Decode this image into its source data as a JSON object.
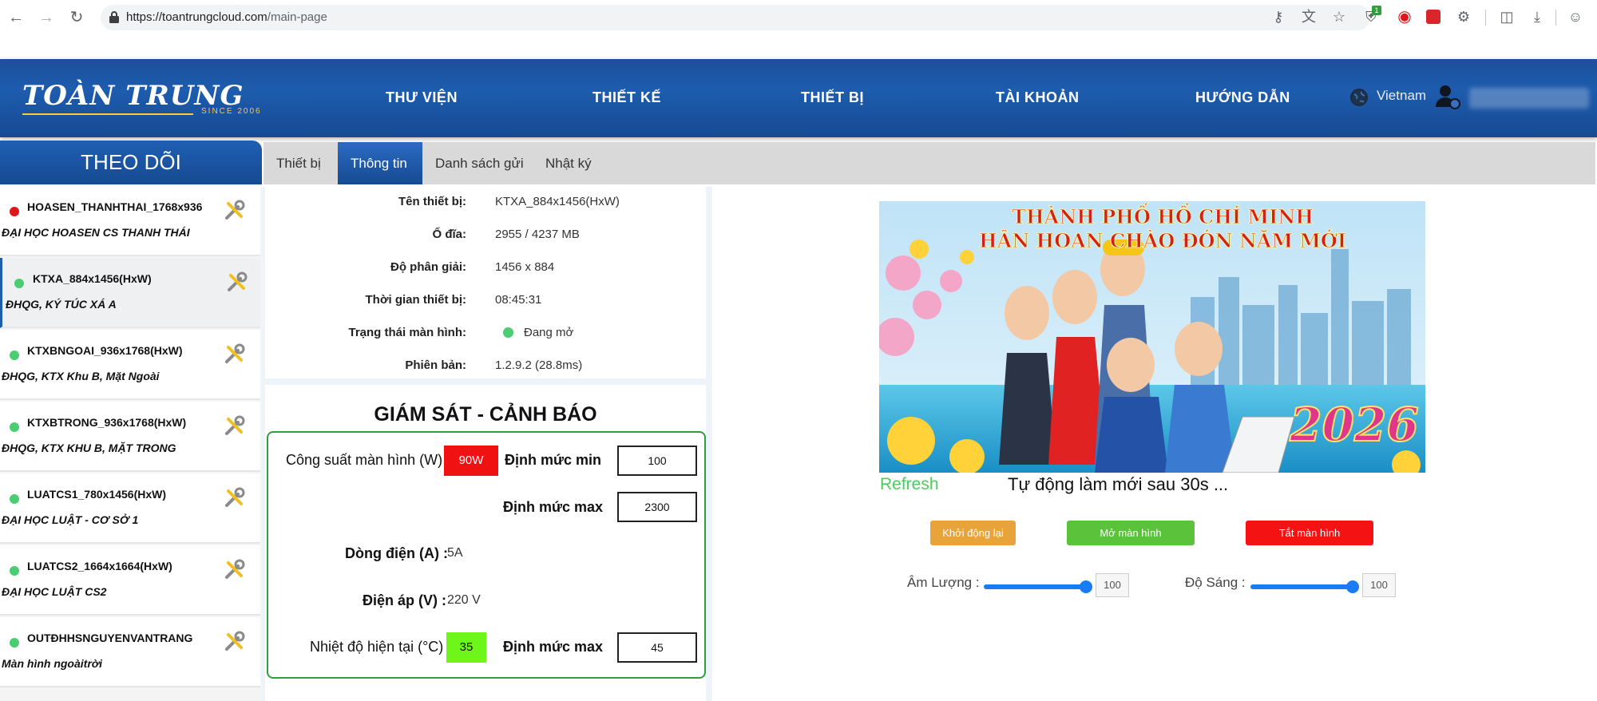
{
  "browser": {
    "url_host": "https://toantrungcloud.com",
    "url_path": "/main-page",
    "badge_count": "1"
  },
  "header": {
    "logo": "TOÀN TRUNG",
    "logo_sub": "SINCE 2006",
    "nav": [
      "THƯ VIỆN",
      "THIẾT KẾ",
      "THIẾT BỊ",
      "TÀI KHOẢN",
      "HƯỚNG DẪN"
    ],
    "language": "Vietnam"
  },
  "sidebar": {
    "title": "THEO DÕI",
    "items": [
      {
        "name": "HOASEN_THANHTHAI_1768x936",
        "desc": "ĐẠI HỌC HOASEN CS THANH THÁI",
        "status": "#e0161a"
      },
      {
        "name": "KTXA_884x1456(HxW)",
        "desc": "ĐHQG, KÝ TÚC XÁ A",
        "status": "#4ccd72"
      },
      {
        "name": "KTXBNGOAI_936x1768(HxW)",
        "desc": "ĐHQG, KTX Khu B, Mặt Ngoài",
        "status": "#4ccd72"
      },
      {
        "name": "KTXBTRONG_936x1768(HxW)",
        "desc": "ĐHQG, KTX KHU B, MẶT TRONG",
        "status": "#4ccd72"
      },
      {
        "name": "LUATCS1_780x1456(HxW)",
        "desc": "ĐẠI HỌC LUẬT - CƠ SỞ 1",
        "status": "#4ccd72"
      },
      {
        "name": "LUATCS2_1664x1664(HxW)",
        "desc": "ĐẠI HỌC LUẬT CS2",
        "status": "#4ccd72"
      },
      {
        "name": "OUTĐHHSNGUYENVANTRANG",
        "desc": "Màn hình ngoàitrời",
        "status": "#4ccd72"
      }
    ]
  },
  "tabs": [
    "Thiết bị",
    "Thông tin",
    "Danh sách gửi",
    "Nhật ký"
  ],
  "info": {
    "device_name_label": "Tên thiết bị:",
    "device_name": "KTXA_884x1456(HxW)",
    "disk_label": "Ổ đĩa:",
    "disk": "2955 / 4237 MB",
    "resolution_label": "Độ phân giải:",
    "resolution": "1456 x 884",
    "time_label": "Thời gian thiết bị:",
    "time": "08:45:31",
    "screen_state_label": "Trạng thái màn hình:",
    "screen_state": "Đang mở",
    "version_label": "Phiên bản:",
    "version": "1.2.9.2 (28.8ms)"
  },
  "monitor": {
    "title": "GIÁM SÁT - CẢNH BÁO",
    "power_label": "Công suất màn hình (W)",
    "power_value": "90W",
    "min_label": "Định mức min",
    "min_value": "100",
    "max_label": "Định mức max",
    "max_value": "2300",
    "current_label": "Dòng điện (A) :",
    "current_value": "5A",
    "voltage_label": "Điện áp (V) :",
    "voltage_value": "220 V",
    "temp_label": "Nhiệt độ hiện tại (°C)",
    "temp_value": "35",
    "temp_max_label": "Định mức max",
    "temp_max_value": "45"
  },
  "preview": {
    "line1": "THÀNH PHỐ HỒ CHÍ MINH",
    "line2": "HÂN HOAN CHÀO ĐÓN NĂM MỚI",
    "year": "2026",
    "refresh": "Refresh",
    "auto_refresh": "Tự động làm mới sau 30s ..."
  },
  "actions": {
    "restart": "Khởi động lại",
    "screen_on": "Mở màn hình",
    "screen_off": "Tắt màn hình"
  },
  "controls": {
    "volume_label": "Âm Lượng :",
    "volume": "100",
    "brightness_label": "Độ Sáng :",
    "brightness": "100"
  }
}
